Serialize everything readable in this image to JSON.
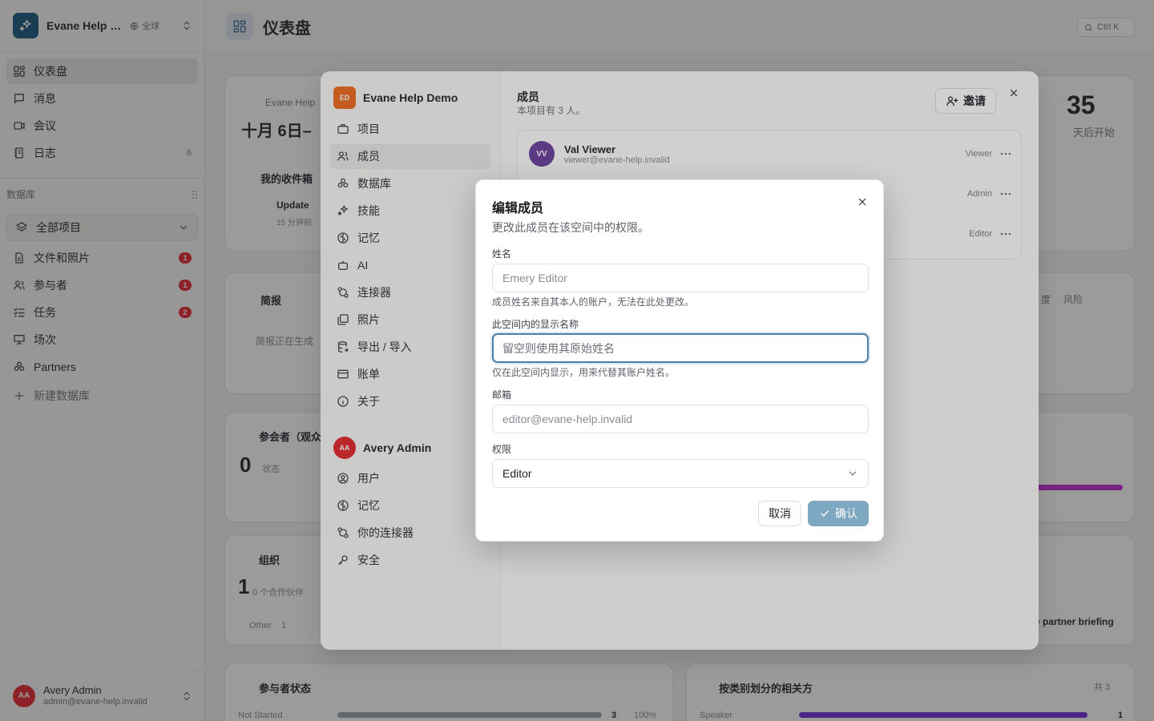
{
  "sidebar": {
    "workspace_initials": "",
    "workspace_name": "Evane Help Demo",
    "workspace_scope": "全球",
    "nav": [
      {
        "label": "仪表盘",
        "icon": "dashboard-icon"
      },
      {
        "label": "消息",
        "icon": "message-icon"
      },
      {
        "label": "会议",
        "icon": "video-icon"
      },
      {
        "label": "日志",
        "icon": "log-icon",
        "count": "6"
      }
    ],
    "section_label": "数据库",
    "db_select": "全部项目",
    "db_items": [
      {
        "label": "文件和照片",
        "badge": "1"
      },
      {
        "label": "参与者",
        "badge": "1"
      },
      {
        "label": "任务",
        "badge": "2"
      },
      {
        "label": "场次",
        "badge": ""
      },
      {
        "label": "Partners",
        "badge": ""
      }
    ],
    "new_db": "新建数据库",
    "user": {
      "initials": "AA",
      "name": "Avery Admin",
      "email": "admin@evane-help.invalid"
    }
  },
  "main": {
    "title": "仪表盘",
    "shortcut": "Ctrl K",
    "bg": {
      "event_label": "Evane Help",
      "event_date": "十月 6日–",
      "countdown": "35",
      "countdown_label": "天后开始",
      "inbox": "我的收件箱",
      "update": "Update",
      "update_time": "15 分钟前",
      "brief": "简报",
      "brief_body": "简报正在生成",
      "brief_tab1": "度",
      "brief_tab2": "风险",
      "participants": "参会者（观众）",
      "participants_count": "0",
      "participants_sub": "状态",
      "org": "组织",
      "org_count": "1",
      "org_sub": "0 个合作伙伴",
      "other": "Other",
      "other_count": "1",
      "status": "参与者状态",
      "not_started": "Not Started",
      "ns_count": "3",
      "ns_pct": "100%",
      "relations": "按类别划分的相关方",
      "rel_total": "共 3",
      "speaker": "Speaker",
      "speaker_count": "1",
      "partner_brief": "e partner briefing"
    }
  },
  "settings": {
    "org_initials": "ED",
    "org_name": "Evane Help Demo",
    "project_items": [
      "项目",
      "成员",
      "数据库",
      "技能",
      "记忆",
      "AI",
      "连接器",
      "照片",
      "导出 / 导入",
      "账单",
      "关于"
    ],
    "user_initials": "AA",
    "user_name": "Avery Admin",
    "user_items": [
      "用户",
      "记忆",
      "你的连接器",
      "安全"
    ],
    "members_title": "成员",
    "members_sub": "本项目有 3 人。",
    "invite": "邀请",
    "members": [
      {
        "initials": "VV",
        "name": "Val Viewer",
        "email": "viewer@evane-help.invalid",
        "role": "Viewer"
      },
      {
        "initials": "",
        "name": "",
        "email": "",
        "role": "Admin"
      },
      {
        "initials": "",
        "name": "",
        "email": "",
        "role": "Editor"
      }
    ]
  },
  "dialog": {
    "title": "编辑成员",
    "description": "更改此成员在该空间中的权限。",
    "name_label": "姓名",
    "name_value": "Emery Editor",
    "name_help": "成员姓名来自其本人的账户，无法在此处更改。",
    "display_label": "此空间内的显示名称",
    "display_placeholder": "留空则使用其原始姓名",
    "display_help": "仅在此空间内显示，用来代替其账户姓名。",
    "email_label": "邮箱",
    "email_value": "editor@evane-help.invalid",
    "role_label": "权限",
    "role_value": "Editor",
    "cancel": "取消",
    "confirm": "确认"
  },
  "colors": {
    "accent": "#12567b",
    "danger": "#e5252e",
    "confirm": "#7ea8c2",
    "org": "#f06a1d"
  }
}
